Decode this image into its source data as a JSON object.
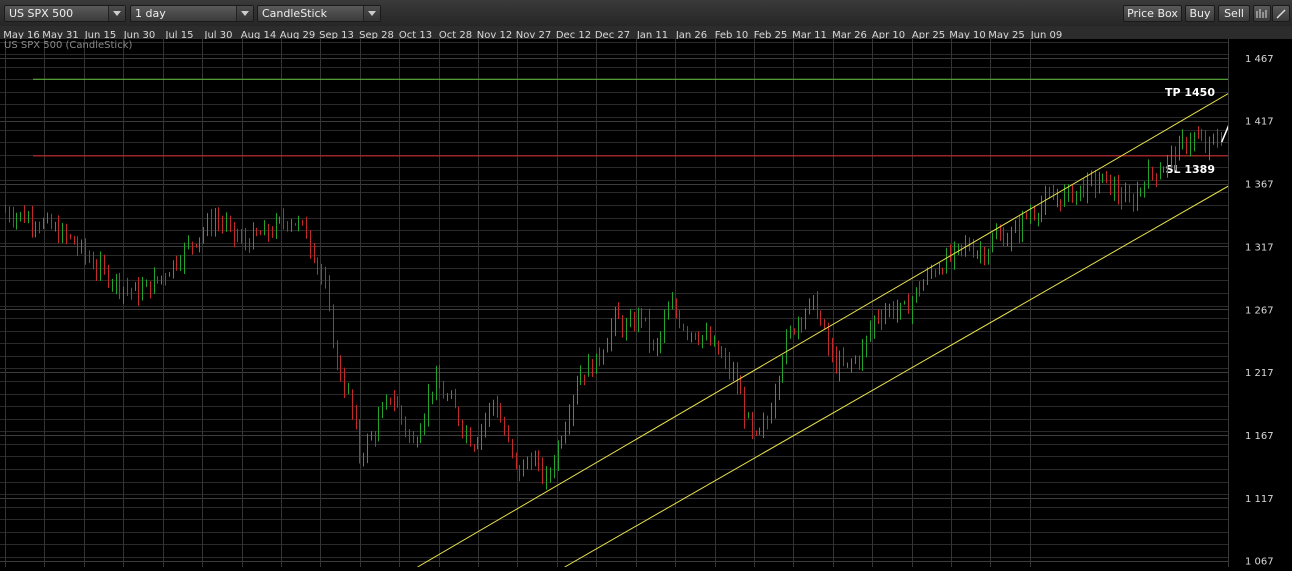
{
  "toolbar": {
    "symbol": "US SPX 500",
    "interval": "1 day",
    "chart_type": "CandleStick",
    "price_box_label": "Price Box",
    "buy_label": "Buy",
    "sell_label": "Sell",
    "bars_icon": "bar-chart-icon",
    "draw_icon": "pencil-line-icon"
  },
  "chart_label": "US SPX 500 (CandleStick)",
  "colors": {
    "up": "#22a32b",
    "down": "#c22a2a",
    "channel": "#e9e24a",
    "tp_line": "#5fc03c",
    "sl_line": "#d8282a",
    "projection": "#ffffff",
    "grid": "#2a2a2a"
  },
  "chart_data": {
    "type": "candlestick",
    "title": "US SPX 500 (CandleStick)",
    "x_tick_labels": [
      "May 16",
      "May 31",
      "Jun 15",
      "Jun 30",
      "Jul 15",
      "Jul 30",
      "Aug 14",
      "Aug 29",
      "Sep 13",
      "Sep 28",
      "Oct 13",
      "Oct 28",
      "Nov 12",
      "Nov 27",
      "Dec 12",
      "Dec 27",
      "Jan 11",
      "Jan 26",
      "Feb 10",
      "Feb 25",
      "Mar 11",
      "Mar 26",
      "Apr 10",
      "Apr 25",
      "May 10",
      "May 25",
      "Jun 09"
    ],
    "y_tick_labels": [
      "1 467",
      "1 417",
      "1 367",
      "1 317",
      "1 267",
      "1 217",
      "1 167",
      "1 117",
      "1 067"
    ],
    "y_ticks": [
      1467,
      1417,
      1367,
      1317,
      1267,
      1217,
      1167,
      1117,
      1067
    ],
    "ylim": [
      1062,
      1482
    ],
    "x_range_days": [
      0,
      395
    ],
    "grid": true,
    "close_path": [
      [
        0,
        1345
      ],
      [
        12,
        1338
      ],
      [
        25,
        1322
      ],
      [
        35,
        1300
      ],
      [
        45,
        1285
      ],
      [
        50,
        1280
      ],
      [
        58,
        1290
      ],
      [
        70,
        1318
      ],
      [
        80,
        1340
      ],
      [
        90,
        1320
      ],
      [
        100,
        1328
      ],
      [
        108,
        1340
      ],
      [
        114,
        1330
      ],
      [
        118,
        1310
      ],
      [
        122,
        1280
      ],
      [
        126,
        1225
      ],
      [
        131,
        1195
      ],
      [
        135,
        1150
      ],
      [
        140,
        1168
      ],
      [
        147,
        1200
      ],
      [
        155,
        1158
      ],
      [
        163,
        1210
      ],
      [
        170,
        1190
      ],
      [
        178,
        1160
      ],
      [
        186,
        1195
      ],
      [
        195,
        1135
      ],
      [
        200,
        1150
      ],
      [
        206,
        1130
      ],
      [
        212,
        1170
      ],
      [
        218,
        1215
      ],
      [
        225,
        1225
      ],
      [
        232,
        1260
      ],
      [
        237,
        1250
      ],
      [
        242,
        1265
      ],
      [
        247,
        1230
      ],
      [
        253,
        1270
      ],
      [
        259,
        1252
      ],
      [
        266,
        1245
      ],
      [
        272,
        1230
      ],
      [
        278,
        1210
      ],
      [
        285,
        1160
      ],
      [
        290,
        1178
      ],
      [
        296,
        1235
      ],
      [
        302,
        1262
      ],
      [
        308,
        1272
      ],
      [
        315,
        1225
      ],
      [
        320,
        1220
      ],
      [
        326,
        1232
      ],
      [
        331,
        1262
      ],
      [
        337,
        1268
      ],
      [
        342,
        1265
      ],
      [
        348,
        1285
      ],
      [
        354,
        1300
      ],
      [
        360,
        1308
      ],
      [
        366,
        1318
      ],
      [
        372,
        1312
      ],
      [
        377,
        1325
      ],
      [
        383,
        1325
      ],
      [
        388,
        1340
      ],
      [
        394,
        1350
      ],
      [
        400,
        1355
      ],
      [
        405,
        1358
      ],
      [
        412,
        1366
      ],
      [
        418,
        1370
      ],
      [
        423,
        1360
      ],
      [
        428,
        1350
      ],
      [
        434,
        1372
      ],
      [
        440,
        1380
      ],
      [
        447,
        1395
      ],
      [
        452,
        1405
      ],
      [
        457,
        1395
      ],
      [
        463,
        1405
      ]
    ],
    "tp_line": {
      "label": "TP 1450",
      "value": 1450
    },
    "sl_line": {
      "label": "SL 1389",
      "value": 1389
    },
    "channel_upper": [
      [
        157,
        1062
      ],
      [
        501,
        1482
      ]
    ],
    "channel_lower": [
      [
        213,
        1062
      ],
      [
        563,
        1482
      ]
    ],
    "projection": [
      [
        463,
        1400
      ],
      [
        467,
        1420
      ],
      [
        472,
        1405
      ],
      [
        478,
        1450
      ]
    ],
    "target_marker": [
      478,
      1450
    ]
  }
}
